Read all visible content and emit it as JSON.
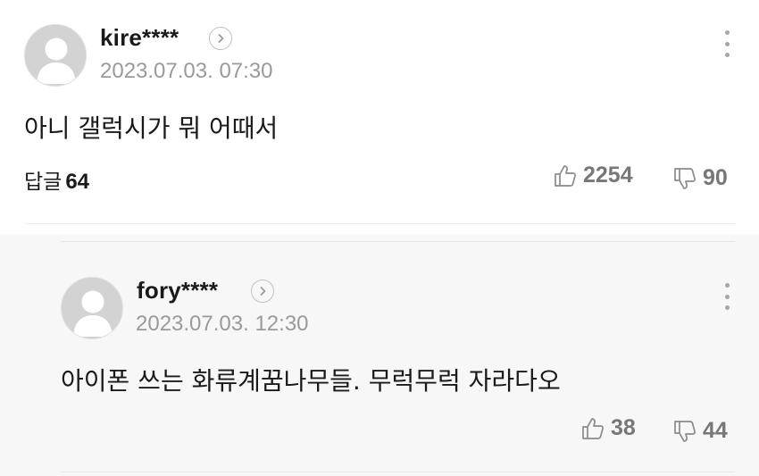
{
  "comment": {
    "username": "kire****",
    "timestamp": "2023.07.03. 07:30",
    "text": "아니 갤럭시가 뭐 어때서",
    "replies_label": "답글",
    "replies_count": "64",
    "likes": "2254",
    "dislikes": "90"
  },
  "reply": {
    "username": "fory****",
    "timestamp": "2023.07.03. 12:30",
    "text": "아이폰 쓰는 화류계꿈나무들. 무럭무럭 자라다오",
    "likes": "38",
    "dislikes": "44"
  },
  "icons": {
    "avatar": "default-avatar-icon",
    "profile": "chevron-right-circle-icon",
    "more": "more-vertical-icon",
    "like": "thumbs-up-icon",
    "dislike": "thumbs-down-icon"
  },
  "colors": {
    "text": "#1a1a1a",
    "meta": "#9a9a9a",
    "count": "#777777",
    "reply_background": "#f7f7f7"
  }
}
